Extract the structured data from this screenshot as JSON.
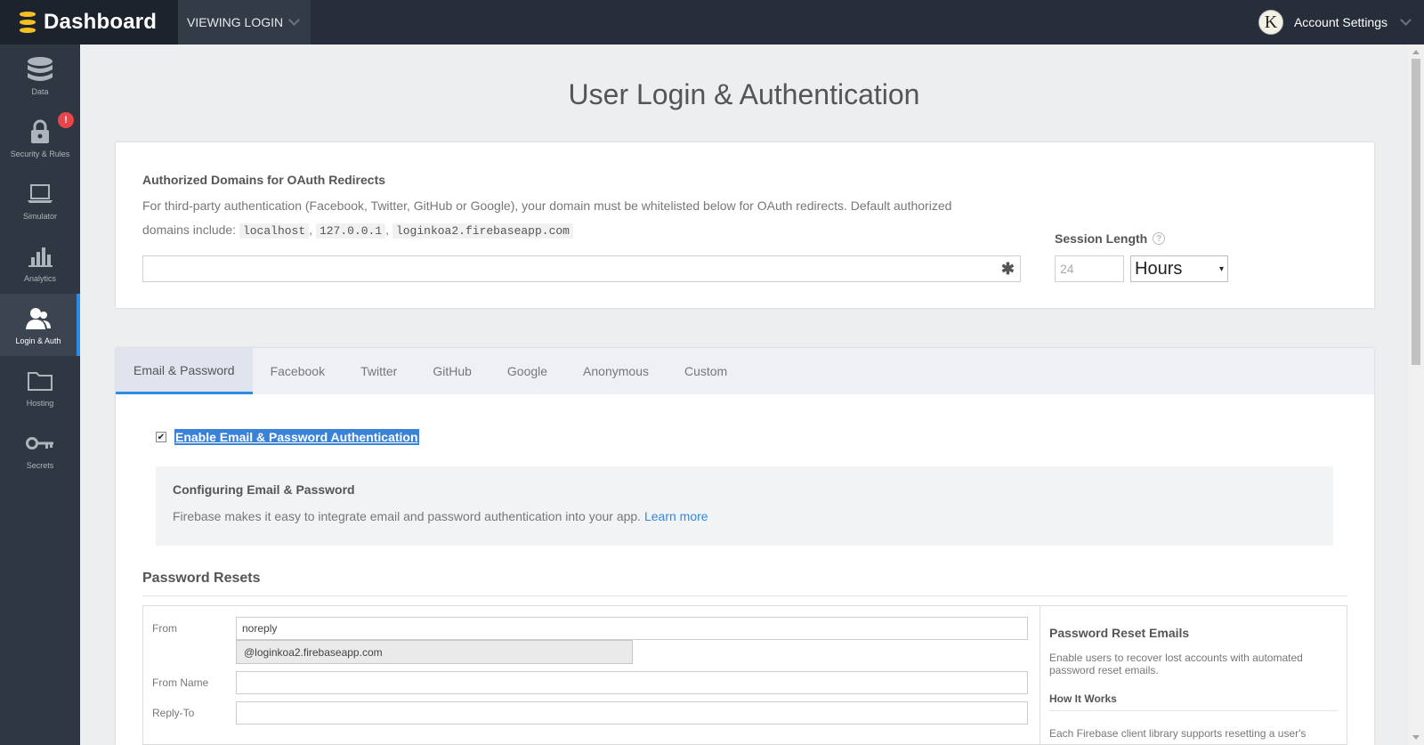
{
  "topbar": {
    "brand_title": "Dashboard",
    "brand_icon": "database-stack-icon",
    "viewing_label": "VIEWING LOGIN",
    "account_label": "Account Settings",
    "avatar_letter": "K",
    "brand_color": "#f5c020"
  },
  "sidebar": {
    "items": [
      {
        "label": "Data",
        "icon": "database-icon"
      },
      {
        "label": "Security & Rules",
        "icon": "lock-icon",
        "badge": "!"
      },
      {
        "label": "Simulator",
        "icon": "laptop-icon"
      },
      {
        "label": "Analytics",
        "icon": "bar-chart-icon"
      },
      {
        "label": "Login & Auth",
        "icon": "users-icon",
        "active": true
      },
      {
        "label": "Hosting",
        "icon": "folder-icon"
      },
      {
        "label": "Secrets",
        "icon": "key-icon"
      }
    ]
  },
  "page": {
    "title": "User Login & Authentication"
  },
  "oauth": {
    "heading": "Authorized Domains for OAuth Redirects",
    "description": "For third-party authentication (Facebook, Twitter, GitHub or Google), your domain must be whitelisted below for OAuth redirects. Default authorized",
    "domains_prefix": "domains include:",
    "domains": [
      "localhost",
      "127.0.0.1",
      "loginkoa2.firebaseapp.com"
    ],
    "separator": ",",
    "input_value": "",
    "required_mark": "✱"
  },
  "session": {
    "label": "Session Length",
    "help_glyph": "?",
    "value_placeholder": "24",
    "unit": "Hours",
    "unit_arrow": "▾"
  },
  "tabs": [
    {
      "label": "Email & Password",
      "active": true
    },
    {
      "label": "Facebook"
    },
    {
      "label": "Twitter"
    },
    {
      "label": "GitHub"
    },
    {
      "label": "Google"
    },
    {
      "label": "Anonymous"
    },
    {
      "label": "Custom"
    }
  ],
  "email_auth": {
    "enabled": true,
    "check_glyph": "✔",
    "enable_label": "Enable Email & Password Authentication",
    "config_title": "Configuring Email & Password",
    "config_text": "Firebase makes it easy to integrate email and password authentication into your app.",
    "learn_more": "Learn more"
  },
  "password_resets": {
    "title": "Password Resets",
    "from_label": "From",
    "from_value": "noreply",
    "from_suffix": "@loginkoa2.firebaseapp.com",
    "from_name_label": "From Name",
    "from_name_value": "",
    "reply_to_label": "Reply-To",
    "reply_to_value": "",
    "info_title": "Password Reset Emails",
    "info_text": "Enable users to recover lost accounts with automated password reset emails.",
    "info_sub": "How It Works",
    "info_text2": "Each Firebase client library supports resetting a user's"
  },
  "colors": {
    "accent": "#2b8be5",
    "selection": "#3a82d8",
    "badge": "#e8464b"
  }
}
